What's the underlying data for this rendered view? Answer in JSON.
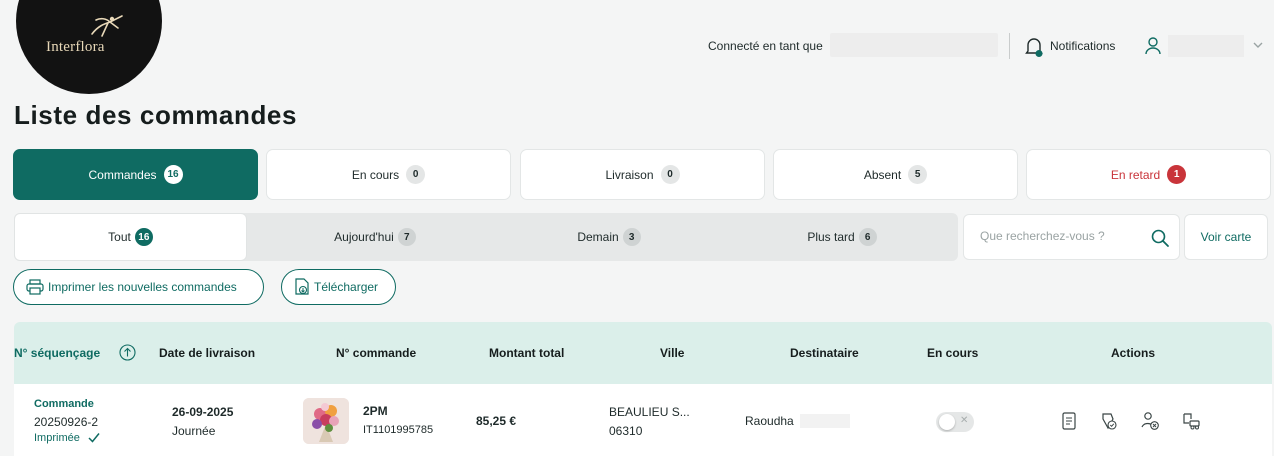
{
  "header": {
    "logo_text": "Interflora",
    "connected_label": "Connecté en tant que",
    "notifications_label": "Notifications"
  },
  "page_title": "Liste des commandes",
  "status_tabs": [
    {
      "label": "Commandes",
      "count": "16"
    },
    {
      "label": "En cours",
      "count": "0"
    },
    {
      "label": "Livraison",
      "count": "0"
    },
    {
      "label": "Absent",
      "count": "5"
    },
    {
      "label": "En retard",
      "count": "1"
    }
  ],
  "date_filters": [
    {
      "label": "Tout",
      "count": "16"
    },
    {
      "label": "Aujourd'hui",
      "count": "7"
    },
    {
      "label": "Demain",
      "count": "3"
    },
    {
      "label": "Plus tard",
      "count": "6"
    }
  ],
  "search": {
    "placeholder": "Que recherchez-vous ?"
  },
  "map_button": "Voir carte",
  "actions": {
    "print_label": "Imprimer les nouvelles commandes",
    "download_label": "Télécharger"
  },
  "table": {
    "columns": [
      "N° séquençage",
      "Date de livraison",
      "N° commande",
      "Montant total",
      "Ville",
      "Destinataire",
      "En cours",
      "Actions"
    ],
    "rows": [
      {
        "type_label": "Commande",
        "sequence": "20250926-2",
        "print_status": "Imprimée",
        "delivery_date": "26-09-2025",
        "delivery_slot": "Journée",
        "product": "2PM",
        "order_id": "IT1101995785",
        "amount": "85,25 €",
        "city": "BEAULIEU S...",
        "zip": "06310",
        "recipient": "Raoudha",
        "in_progress": false
      }
    ]
  },
  "colors": {
    "brand": "#0f6b62",
    "late": "#c9343a",
    "header_row": "#dbefea"
  }
}
